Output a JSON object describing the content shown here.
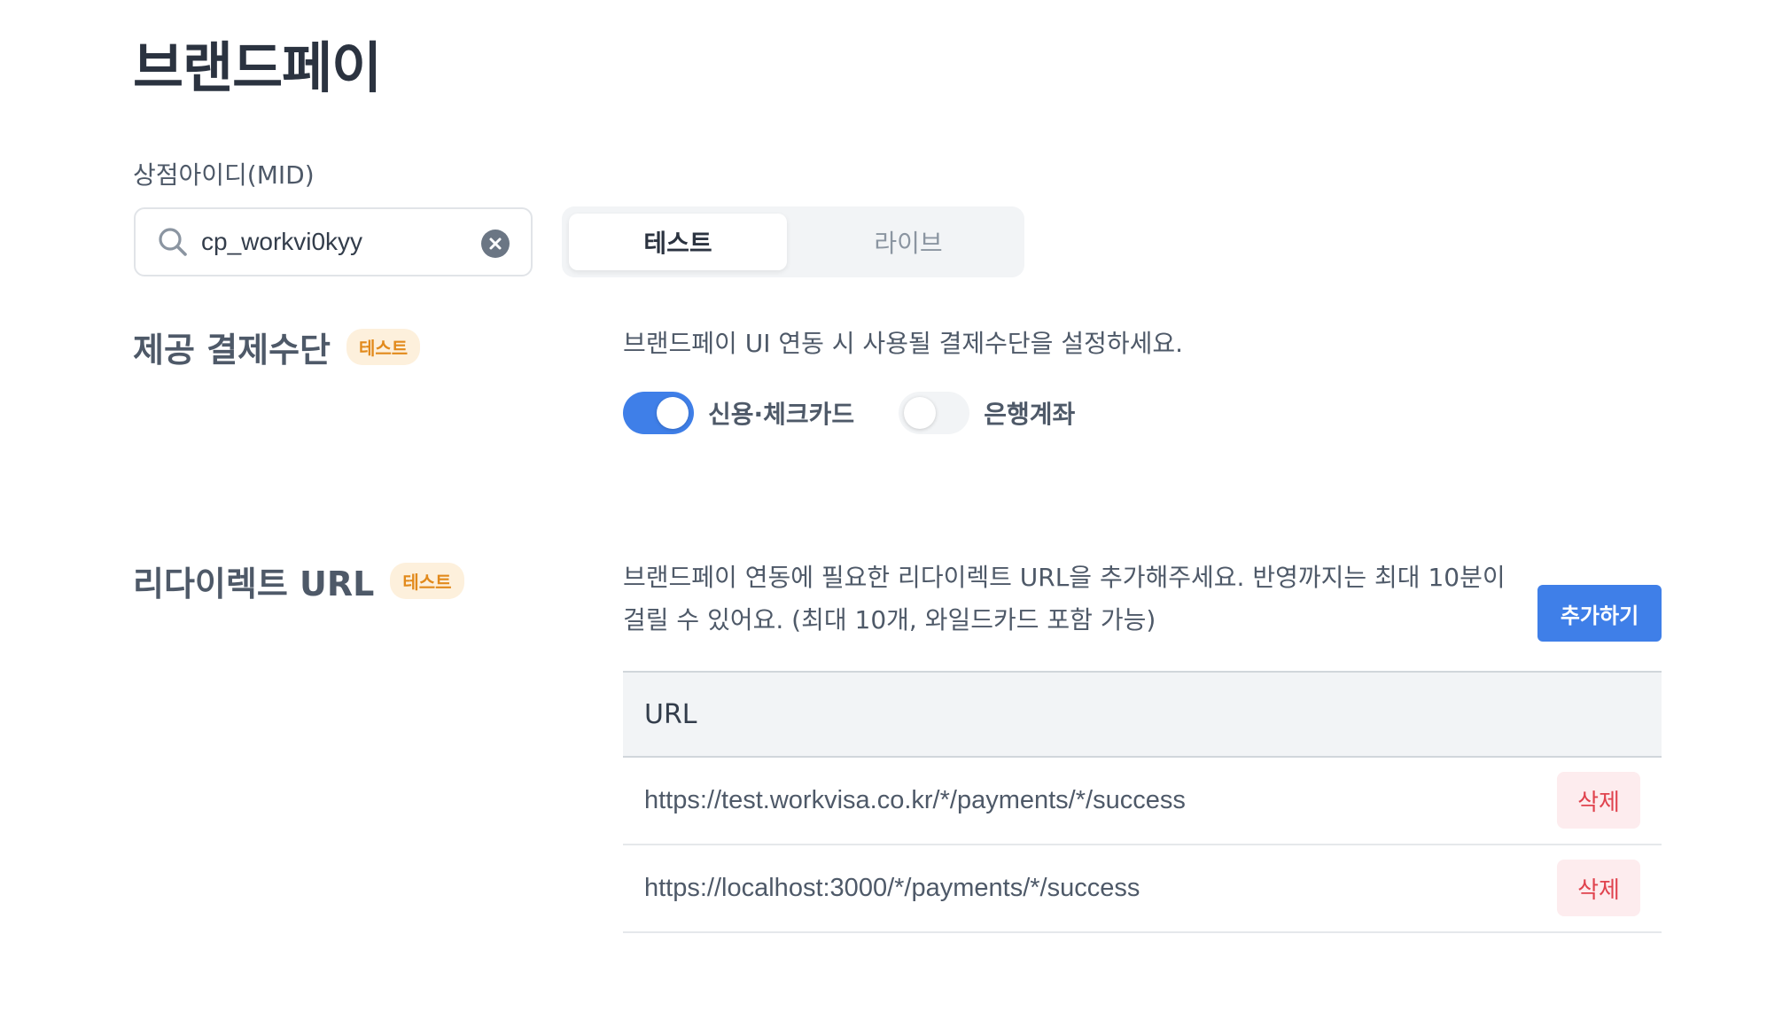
{
  "page_title": "브랜드페이",
  "mid": {
    "label": "상점아이디(MID)",
    "value": "cp_workvi0kyy",
    "search_icon": "search-icon",
    "clear_icon": "close-circle-icon"
  },
  "mode_tabs": {
    "test_label": "테스트",
    "live_label": "라이브",
    "selected": "테스트"
  },
  "payment_methods": {
    "title": "제공 결제수단",
    "badge": "테스트",
    "description": "브랜드페이 UI 연동 시 사용될 결제수단을 설정하세요.",
    "toggles": [
      {
        "label": "신용·체크카드",
        "on": true
      },
      {
        "label": "은행계좌",
        "on": false
      }
    ]
  },
  "redirect": {
    "title": "리다이렉트 URL",
    "badge": "테스트",
    "description_line1": "브랜드페이 연동에 필요한 리다이렉트 URL을 추가해주세요. 반영까지는 최대 10분이",
    "description_line2": "걸릴 수 있어요. (최대 10개, 와일드카드 포함 가능)",
    "add_button": "추가하기",
    "table_header": "URL",
    "rows": [
      {
        "url": "https://test.workvisa.co.kr/*/payments/*/success",
        "delete_label": "삭제"
      },
      {
        "url": "https://localhost:3000/*/payments/*/success",
        "delete_label": "삭제"
      }
    ]
  },
  "colors": {
    "accent": "#3f7fe8",
    "badge_bg": "#fdf0dc",
    "badge_text": "#e28a1c",
    "delete_bg": "#fdecee",
    "delete_text": "#e0434e"
  }
}
